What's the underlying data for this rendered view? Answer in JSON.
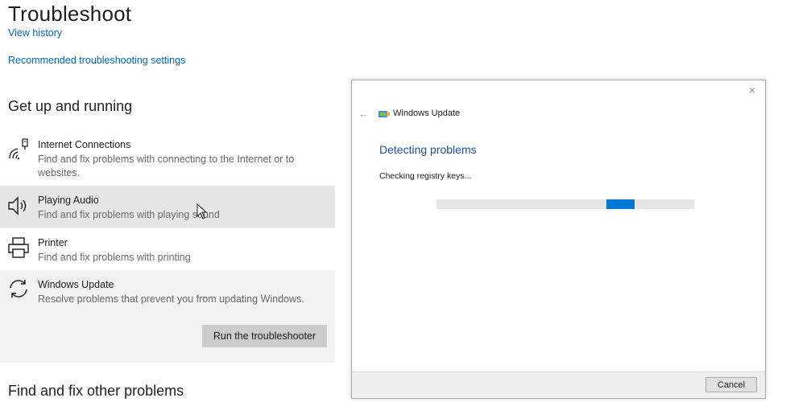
{
  "page": {
    "title": "Troubleshoot",
    "view_history_link": "View history",
    "recommended_link": "Recommended troubleshooting settings",
    "section_running": "Get up and running",
    "section_other": "Find and fix other problems"
  },
  "items": [
    {
      "title": "Internet Connections",
      "desc": "Find and fix problems with connecting to the Internet or to websites.",
      "icon": "wifi-icon"
    },
    {
      "title": "Playing Audio",
      "desc": "Find and fix problems with playing sound",
      "icon": "speaker-icon"
    },
    {
      "title": "Printer",
      "desc": "Find and fix problems with printing",
      "icon": "printer-icon"
    },
    {
      "title": "Windows Update",
      "desc": "Resolve problems that prevent you from updating Windows.",
      "icon": "refresh-icon"
    }
  ],
  "run_button": "Run the troubleshooter",
  "dialog": {
    "back": "←",
    "close": "×",
    "app_title": "Windows Update",
    "heading": "Detecting problems",
    "status": "Checking registry keys...",
    "progress_segment_start": 0.66,
    "cancel": "Cancel"
  },
  "colors": {
    "link": "#0067b8",
    "progress": "#0078d7",
    "heading": "#1f4e9e"
  }
}
